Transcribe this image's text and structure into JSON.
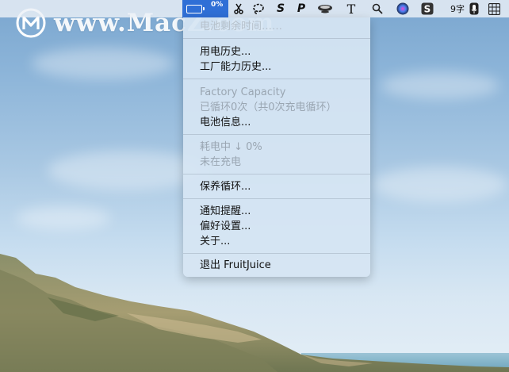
{
  "watermark": {
    "text": "www.MacZ.com"
  },
  "menubar": {
    "battery_percent": "0%",
    "ime_label": "9字",
    "status_icons": [
      "scissors-icon",
      "lasso-icon",
      "s-app-icon",
      "p-app-icon",
      "teacup-icon",
      "text-tool-icon",
      "spotlight-icon",
      "siri-icon",
      "s-square-icon",
      "ime-icon",
      "microphone-icon",
      "grid-icon"
    ]
  },
  "menu": {
    "partial_top_text": "电池剩余时间……",
    "items": {
      "usage_history": "用电历史...",
      "capacity_history": "工厂能力历史...",
      "factory_capacity": "Factory Capacity",
      "cycle_count": "已循环0次（共0次充电循环）",
      "battery_info": "电池信息...",
      "drain_rate": "耗电中 ↓ 0%",
      "not_charging": "未在充电",
      "maintenance_cycle": "保养循环...",
      "notifications": "通知提醒...",
      "preferences": "偏好设置...",
      "about": "关于...",
      "quit": "退出 FruitJuice"
    }
  },
  "colors": {
    "accent": "#2f6fd6",
    "menu_bg": "#d6e5f3",
    "disabled_text": "#9aa6b2"
  }
}
